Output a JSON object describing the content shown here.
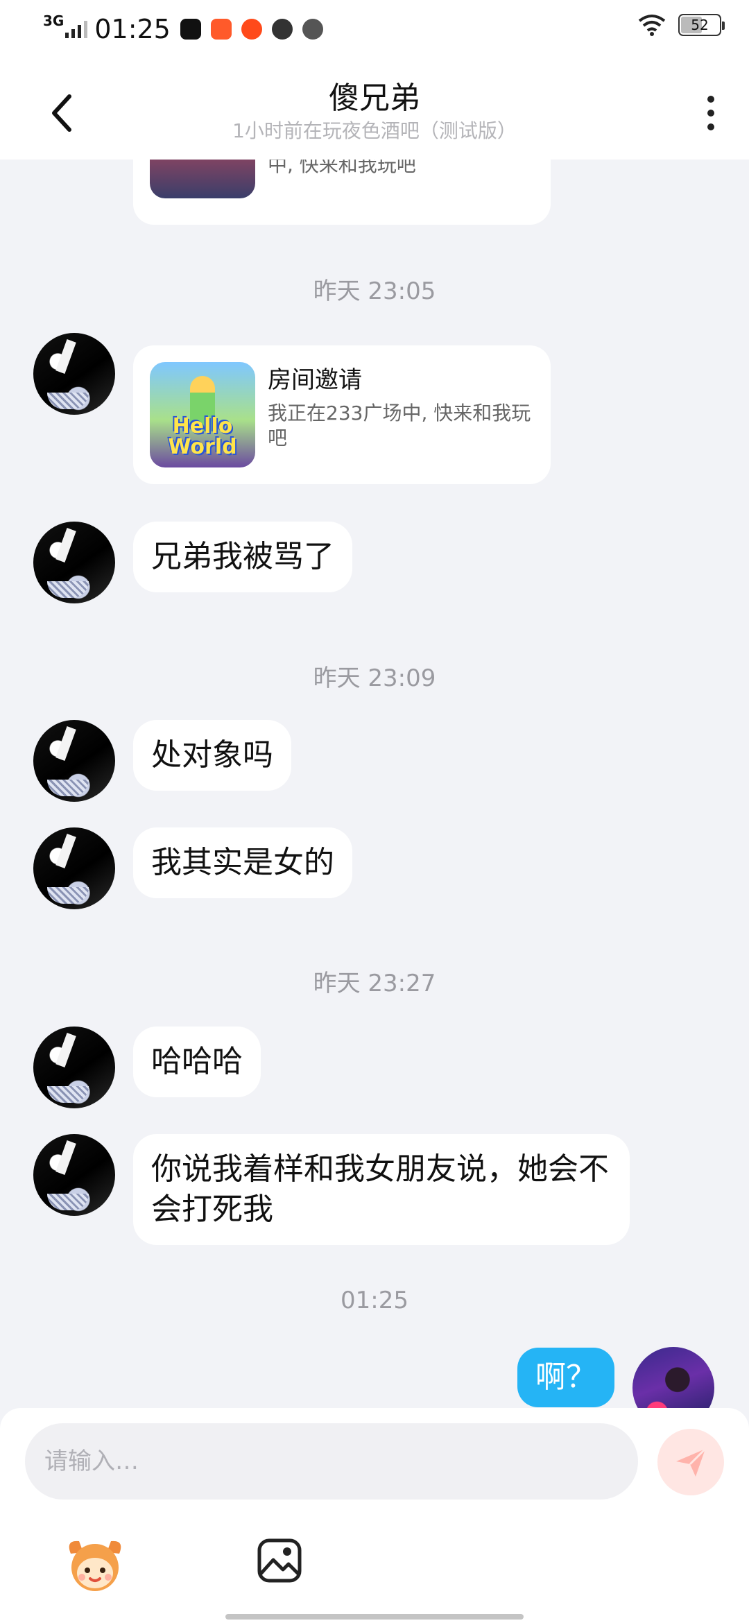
{
  "status_bar": {
    "network": "3G",
    "time": "01:25",
    "battery": "52"
  },
  "header": {
    "title": "傻兄弟",
    "subtitle": "1小时前在玩夜色酒吧（测试版）"
  },
  "partial_card": {
    "desc_tail": "中, 快来和我玩吧"
  },
  "messages": {
    "ts1": "昨天 23:05",
    "invite": {
      "title": "房间邀请",
      "desc": "我正在233广场中, 快来和我玩吧",
      "thumb_text": "Hello World"
    },
    "m1": "兄弟我被骂了",
    "ts2": "昨天 23:09",
    "m2": "处对象吗",
    "m3": "我其实是女的",
    "ts3": "昨天 23:27",
    "m4": "哈哈哈",
    "m5": "你说我着样和我女朋友说，她会不会打死我",
    "ts4": "01:25",
    "me1": "啊？"
  },
  "input": {
    "placeholder": "请输入…"
  },
  "colors": {
    "my_bubble": "#25b4f5",
    "background": "#f2f3f7"
  }
}
